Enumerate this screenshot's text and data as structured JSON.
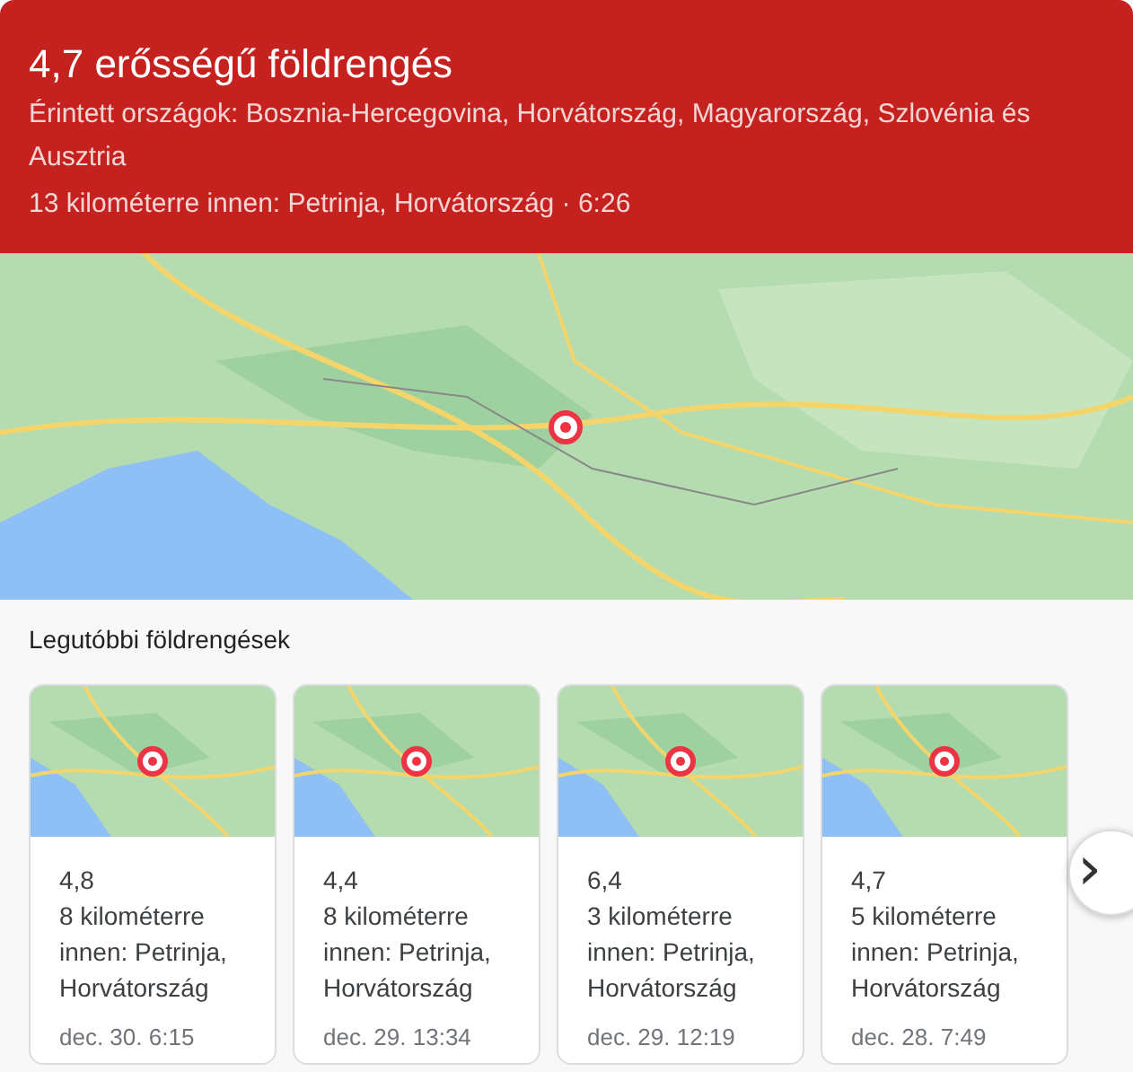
{
  "header": {
    "title": "4,7 erősségű földrengés",
    "affected": "Érintett országok: Bosznia-Hercegovina, Horvátország, Magyarország, Szlovénia és Ausztria",
    "location": "13 kilométerre innen: Petrinja, Horvátország · 6:26"
  },
  "recent": {
    "title": "Legutóbbi földrengések",
    "cards": [
      {
        "kind": "full",
        "magnitude": "4,8",
        "distance": "8 kilométerre innen: Petrinja, Horvátország",
        "date": "dec. 30. 6:15"
      },
      {
        "kind": "full",
        "magnitude": "4,4",
        "distance": "8 kilométerre innen: Petrinja, Horvátország",
        "date": "dec. 29. 13:34"
      },
      {
        "kind": "full",
        "magnitude": "6,4",
        "distance": "3 kilométerre innen: Petrinja, Horvátország",
        "date": "dec. 29. 12:19"
      },
      {
        "kind": "full",
        "magnitude": "4,7",
        "distance": "5 kilométerre innen: Petrinja, Horvátország",
        "date": "dec. 28. 7:49"
      }
    ],
    "next_button": "›"
  }
}
